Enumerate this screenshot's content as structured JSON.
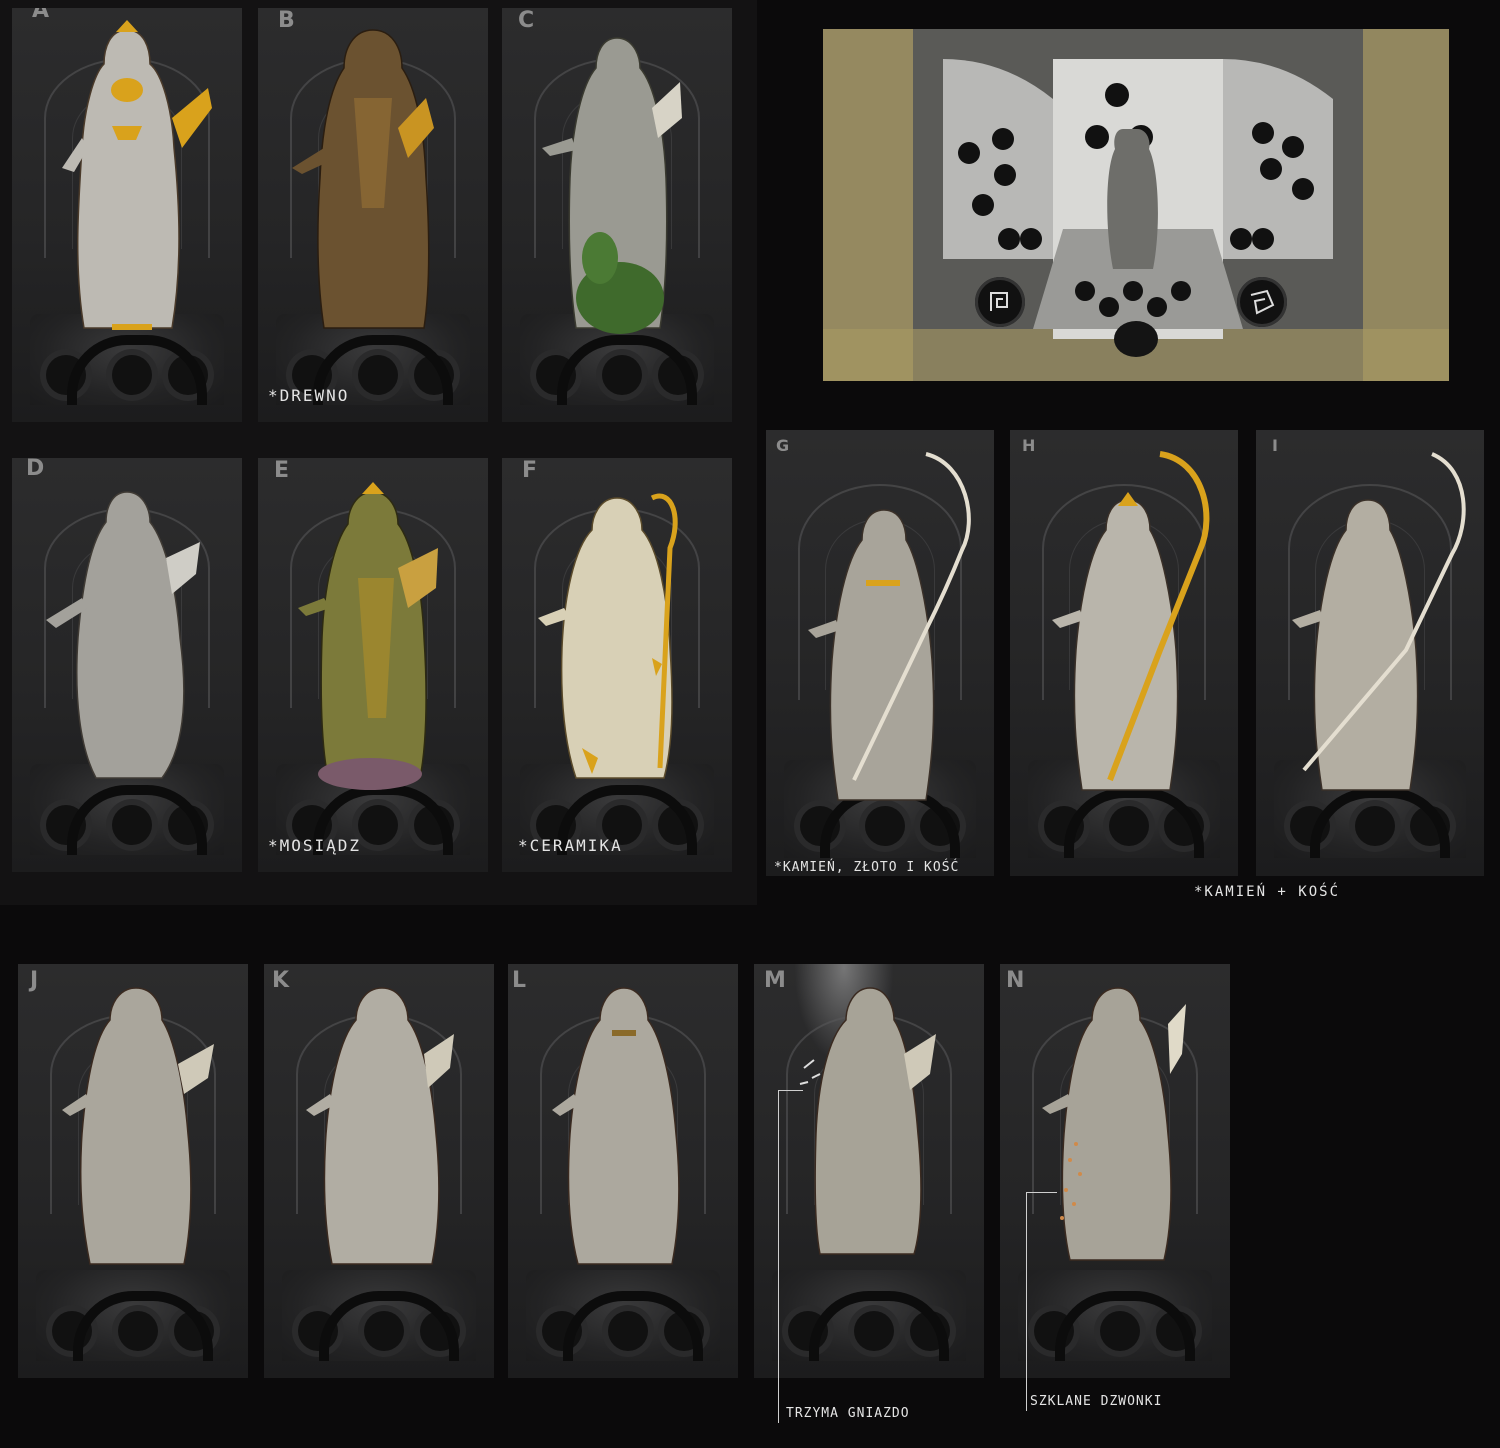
{
  "sheet": {
    "cards": [
      {
        "id": "A",
        "letter": "A",
        "finish": "gold"
      },
      {
        "id": "B",
        "letter": "B",
        "finish": "wood"
      },
      {
        "id": "C",
        "letter": "C",
        "finish": "stone-ivy"
      },
      {
        "id": "D",
        "letter": "D",
        "finish": "stone"
      },
      {
        "id": "E",
        "letter": "E",
        "finish": "brass"
      },
      {
        "id": "F",
        "letter": "F",
        "finish": "ceramic"
      },
      {
        "id": "G",
        "letter": "G",
        "finish": "stone-gold-bone"
      },
      {
        "id": "H",
        "letter": "H",
        "finish": "gold-scythe"
      },
      {
        "id": "I",
        "letter": "I",
        "finish": "stone-bone"
      },
      {
        "id": "J",
        "letter": "J",
        "finish": "stone"
      },
      {
        "id": "K",
        "letter": "K",
        "finish": "stone"
      },
      {
        "id": "L",
        "letter": "L",
        "finish": "stone"
      },
      {
        "id": "M",
        "letter": "M",
        "finish": "stone"
      },
      {
        "id": "N",
        "letter": "N",
        "finish": "stone"
      }
    ],
    "notes": {
      "b": "*DREWNO",
      "e": "*MOSIĄDZ",
      "f": "*CERAMIKA",
      "g": "*KAMIEŃ, ZŁOTO I KOŚĆ",
      "i": "*KAMIEŃ + KOŚĆ",
      "m": "TRZYMA GNIAZDO",
      "n": "SZKLANE DZWONKI"
    },
    "colors": {
      "gold": "#d9a21c",
      "stone": "#c9c6bf",
      "wood": "#6b5230",
      "brass": "#7c7a3a",
      "ivy": "#3f6a2c",
      "ceramic": "#d8d0b6",
      "scene_tint": "#a99a63"
    },
    "scene": {
      "icon_left": "spiral-rune-icon",
      "icon_right": "angular-rune-icon"
    }
  }
}
